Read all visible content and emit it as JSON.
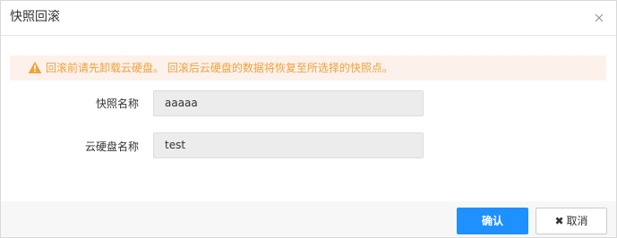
{
  "dialog": {
    "title": "快照回滚",
    "close_icon": "close-icon"
  },
  "warning": {
    "icon": "warning-icon",
    "text": "回滚前请先卸载云硬盘。 回滚后云硬盘的数据将恢复至所选择的快照点。",
    "color": "#f0a23a",
    "background": "#fdf1ec"
  },
  "form": {
    "snapshot_name": {
      "label": "快照名称",
      "value": "aaaaa"
    },
    "disk_name": {
      "label": "云硬盘名称",
      "value": "test"
    }
  },
  "footer": {
    "confirm_label": "确认",
    "cancel_icon": "x-icon",
    "cancel_label": "取消",
    "accent_color": "#1e90ff"
  }
}
